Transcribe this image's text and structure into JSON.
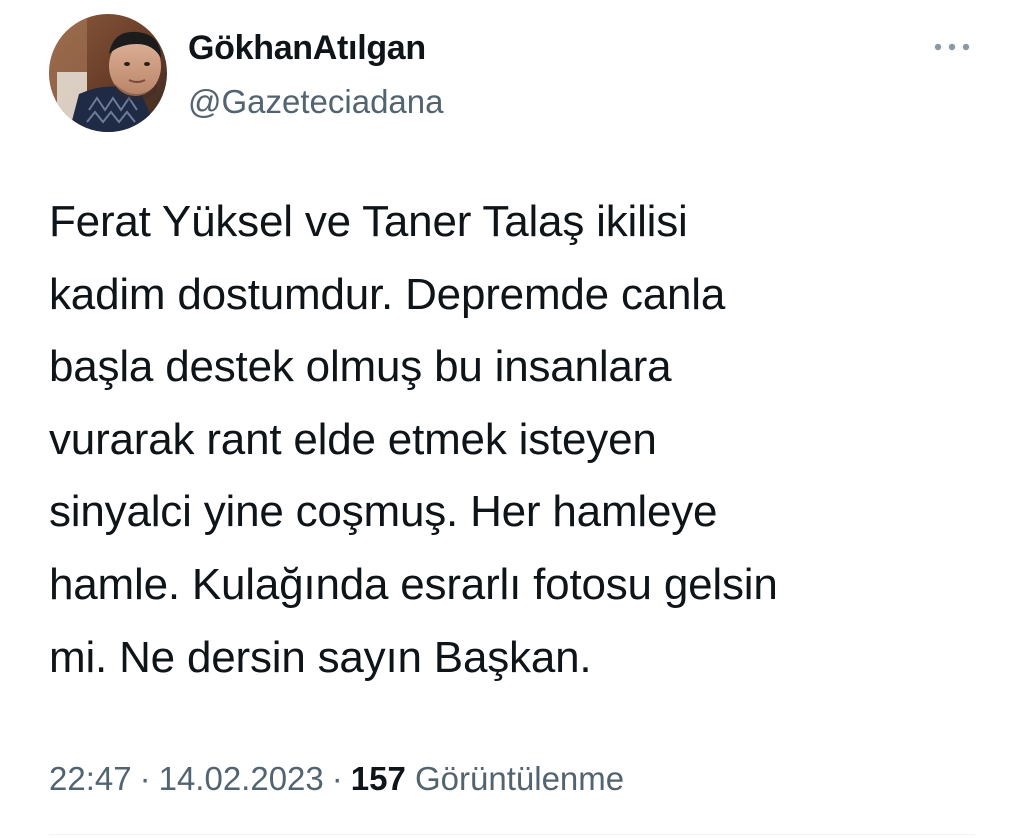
{
  "tweet": {
    "author": {
      "display_name": "GökhanAtılgan",
      "handle": "@Gazeteciadana",
      "avatar_icon": "profile-photo"
    },
    "more_icon": "more-options-icon",
    "text": "Ferat Yüksel ve Taner Talaş ikilisi\nkadim dostumdur. Depremde canla\nbaşla destek olmuş bu insanlara\nvurarak rant elde etmek isteyen\nsinyalci yine coşmuş. Her hamleye\nhamle. Kulağında esrarlı fotosu gelsin\nmi. Ne dersin sayın Başkan.",
    "meta": {
      "time": "22:47",
      "separator": "·",
      "date": "14.02.2023",
      "views_count": "157",
      "views_label": "Görüntülenme"
    }
  },
  "colors": {
    "text_primary": "#0f1419",
    "text_secondary": "#536471",
    "divider": "#eff3f4",
    "more_icon": "#8b98a5"
  }
}
